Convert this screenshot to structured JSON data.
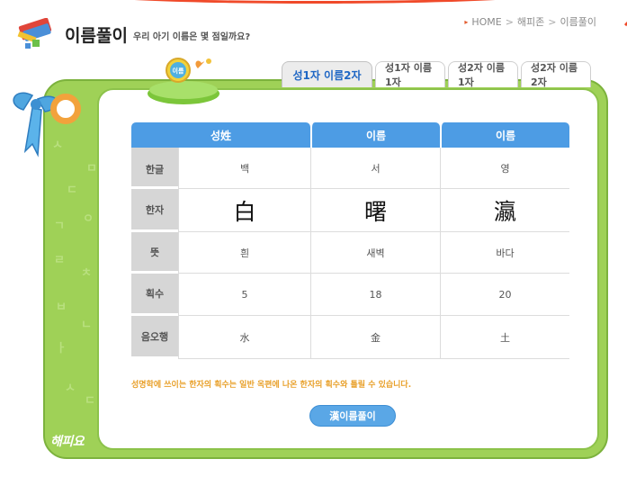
{
  "header": {
    "title": "이름풀이",
    "subtitle": "우리 아기 이름은 몇 점일까요?"
  },
  "breadcrumb": [
    {
      "label": "HOME"
    },
    {
      "label": "해피존"
    },
    {
      "label": "이름풀이"
    }
  ],
  "badge": {
    "label": "이름"
  },
  "tabs": [
    {
      "label": "성1자 이름2자",
      "active": true
    },
    {
      "label": "성1자 이름1자",
      "active": false
    },
    {
      "label": "성2자 이름1자",
      "active": false
    },
    {
      "label": "성2자 이름2자",
      "active": false
    }
  ],
  "table": {
    "headers": [
      "성姓",
      "이름",
      "이름"
    ],
    "rows": [
      {
        "label": "한글",
        "values": [
          "백",
          "서",
          "영"
        ]
      },
      {
        "label": "한자",
        "values": [
          "白",
          "曙",
          "瀛"
        ]
      },
      {
        "label": "뜻",
        "values": [
          "흰",
          "새벽",
          "바다"
        ]
      },
      {
        "label": "획수",
        "values": [
          "5",
          "18",
          "20"
        ]
      },
      {
        "label": "음오행",
        "values": [
          "水",
          "金",
          "土"
        ]
      }
    ]
  },
  "note": "성명학에 쓰이는 한자의 획수는 일반 옥편에 나온 한자의 획수와 틀릴 수 있습니다.",
  "buttons": {
    "analyze": "漢이름풀이"
  },
  "footer": {
    "logo": "해피요"
  },
  "colors": {
    "frame_green": "#9fd157",
    "header_blue": "#4d9ce4",
    "tab_active_text": "#1e66c4",
    "note_orange": "#e8a02a",
    "accent_red": "#f04a2a"
  }
}
